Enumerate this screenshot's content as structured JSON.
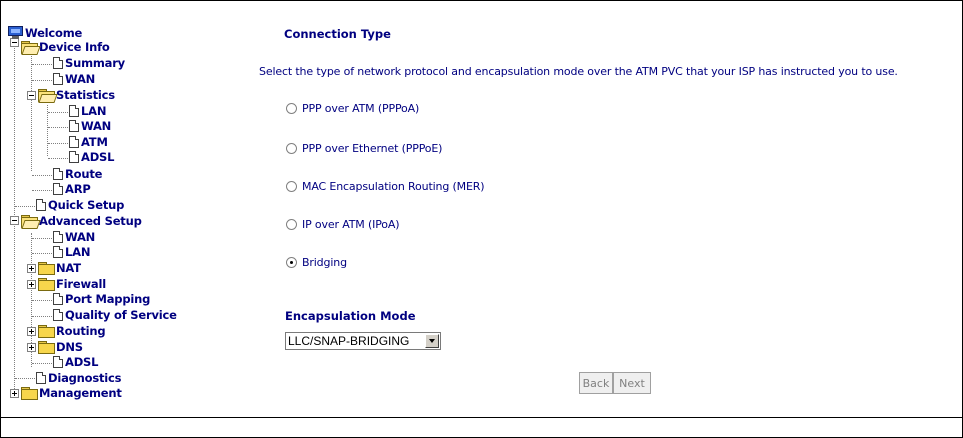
{
  "tree": {
    "welcome": "Welcome",
    "device_info": "Device Info",
    "summary": "Summary",
    "wan": "WAN",
    "statistics": "Statistics",
    "stat_lan": "LAN",
    "stat_wan": "WAN",
    "stat_atm": "ATM",
    "stat_adsl": "ADSL",
    "route": "Route",
    "arp": "ARP",
    "quick_setup": "Quick Setup",
    "advanced_setup": "Advanced Setup",
    "adv_wan": "WAN",
    "adv_lan": "LAN",
    "nat": "NAT",
    "firewall": "Firewall",
    "port_mapping": "Port Mapping",
    "qos": "Quality of Service",
    "routing": "Routing",
    "dns": "DNS",
    "adv_adsl": "ADSL",
    "diagnostics": "Diagnostics",
    "management": "Management"
  },
  "main": {
    "title": "Connection Type",
    "description": "Select the type of network protocol and encapsulation mode over the ATM PVC that your ISP has instructed you to use.",
    "options": [
      {
        "label": "PPP over ATM (PPPoA)",
        "checked": false
      },
      {
        "label": "PPP over Ethernet (PPPoE)",
        "checked": false
      },
      {
        "label": "MAC Encapsulation Routing (MER)",
        "checked": false
      },
      {
        "label": "IP over ATM (IPoA)",
        "checked": false
      },
      {
        "label": "Bridging",
        "checked": true
      }
    ],
    "encap_title": "Encapsulation Mode",
    "encap_value": "LLC/SNAP-BRIDGING",
    "back_label": "Back",
    "next_label": "Next"
  }
}
